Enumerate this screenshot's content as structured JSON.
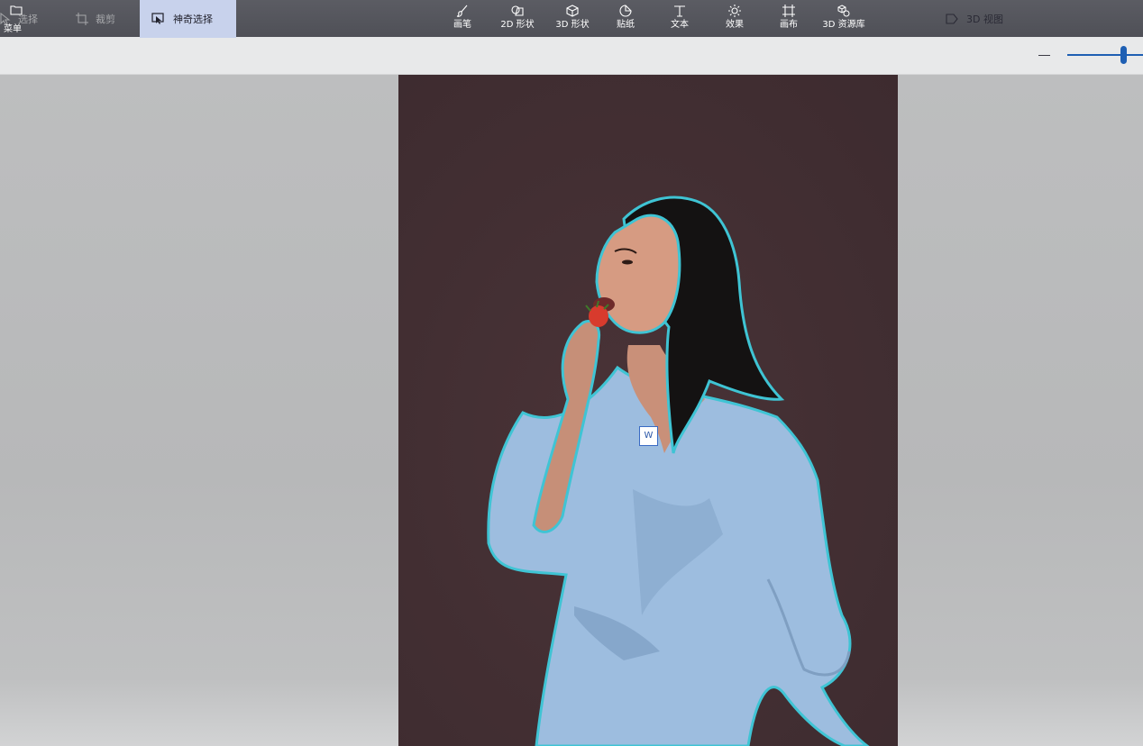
{
  "topbar": {
    "menu": {
      "label": "菜单",
      "icon": "folder-icon"
    },
    "tools": [
      {
        "label": "画笔",
        "icon": "brush-icon"
      },
      {
        "label": "2D 形状",
        "icon": "shapes-2d-icon"
      },
      {
        "label": "3D 形状",
        "icon": "cube-icon"
      },
      {
        "label": "贴纸",
        "icon": "sticker-icon"
      },
      {
        "label": "文本",
        "icon": "text-icon"
      },
      {
        "label": "效果",
        "icon": "effects-sun-icon"
      },
      {
        "label": "画布",
        "icon": "canvas-icon"
      },
      {
        "label": "3D 资源库",
        "icon": "library-3d-icon"
      }
    ]
  },
  "subbar": {
    "select": "选择",
    "crop": "裁剪",
    "magic_select": "神奇选择",
    "view_3d": "3D 视图"
  },
  "canvas": {
    "marker_label": "W"
  },
  "colors": {
    "toolbar_bg": "#55565d",
    "subbar_bg": "#e8e9ea",
    "active_tool_bg": "#c8d2ec",
    "accent": "#1e5fb3",
    "selection_outline": "#3fc4d4",
    "photo_bg": "#432f33"
  }
}
